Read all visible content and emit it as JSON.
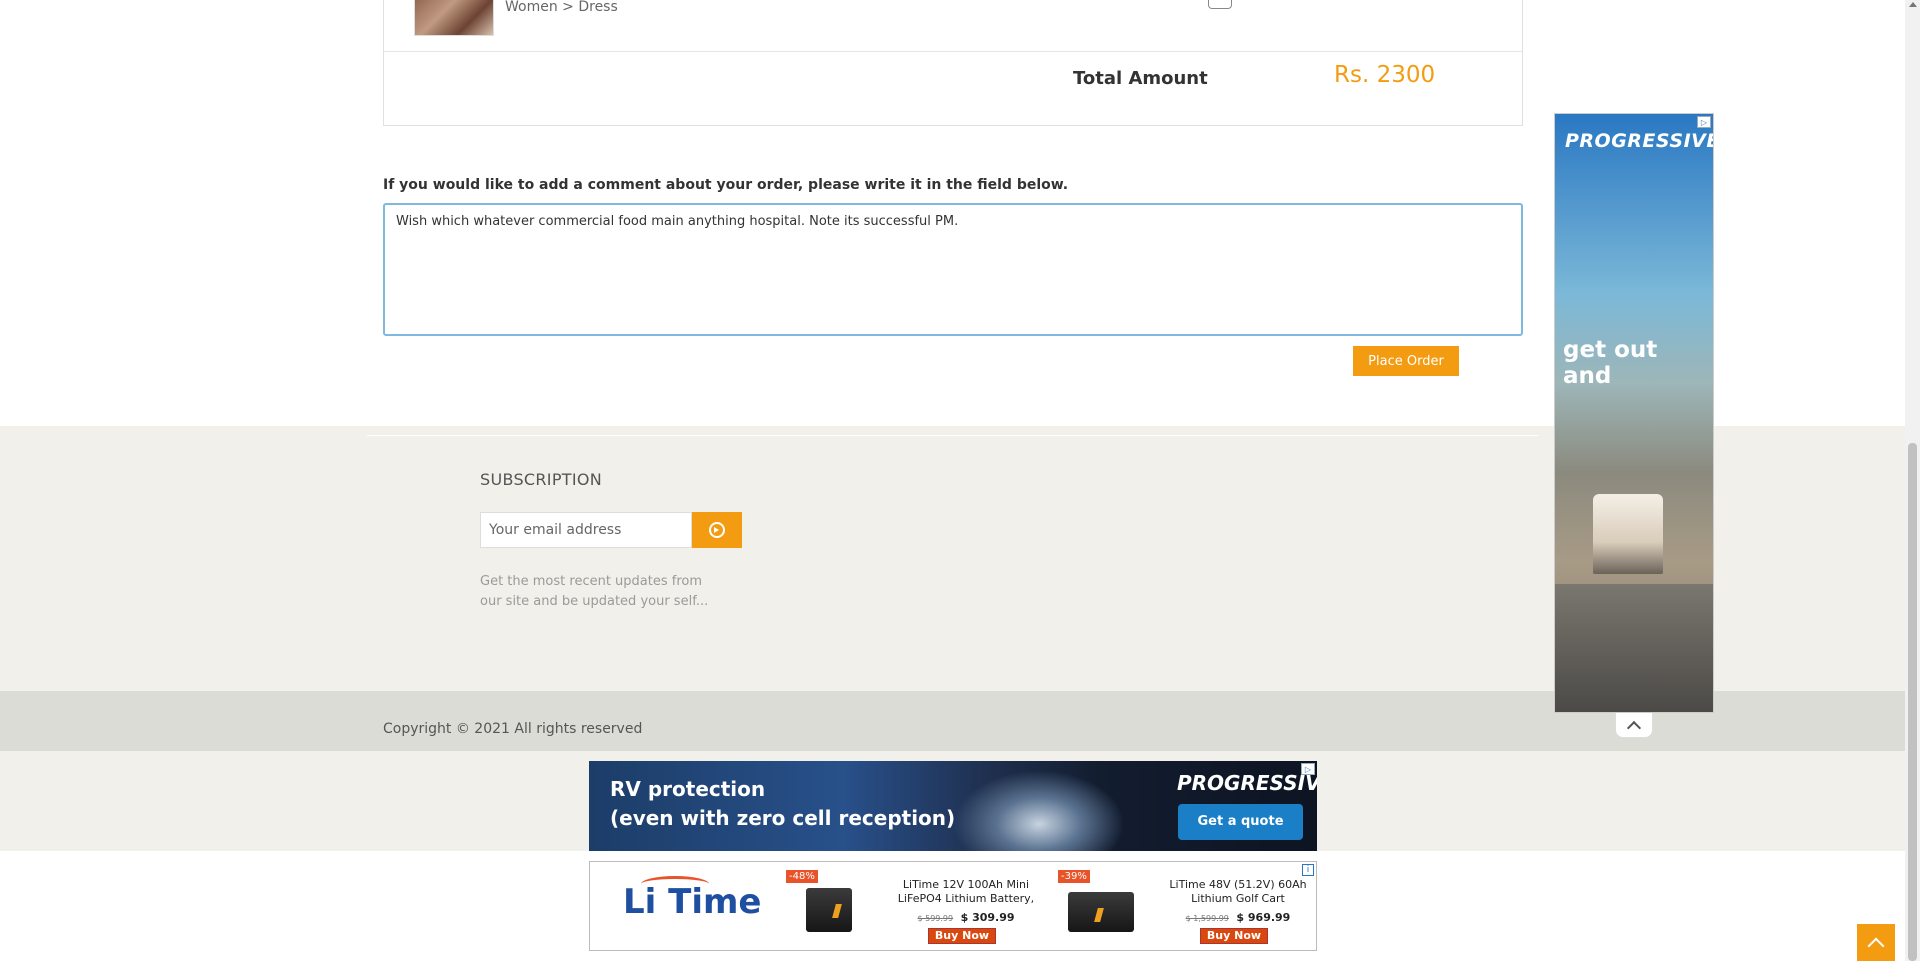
{
  "order": {
    "item_category": "Women > Dress",
    "total_label": "Total Amount",
    "total_value": "Rs. 2300"
  },
  "comment": {
    "label": "If you would like to add a comment about your order, please write it in the field below.",
    "value": "Wish which whatever commercial food main anything hospital. Note its successful PM."
  },
  "place_order_label": "Place Order",
  "footer": {
    "subscription_title": "SUBSCRIPTION",
    "email_placeholder": "Your email address",
    "subscription_desc": "Get the most recent updates from our site and be updated your self...",
    "copyright": "Copyright © 2021 All rights reserved"
  },
  "ads": {
    "side": {
      "brand": "PROGRESSIVE",
      "tagline": "get out and"
    },
    "banner": {
      "line1": "RV protection",
      "line2": "(even with zero cell reception)",
      "brand": "PROGRESSIVE",
      "cta": "Get a quote"
    },
    "litime": {
      "logo": "Li Time",
      "products": [
        {
          "discount": "-48%",
          "name": "LiTime 12V 100Ah Mini LiFePO4 Lithium Battery,",
          "old_price": "$ 599.99",
          "new_price": "$ 309.99",
          "cta": "Buy Now"
        },
        {
          "discount": "-39%",
          "name": "LiTime 48V (51.2V) 60Ah Lithium Golf Cart",
          "old_price": "$ 1,599.99",
          "new_price": "$ 969.99",
          "cta": "Buy Now"
        }
      ]
    }
  },
  "colors": {
    "accent": "#f39c12",
    "footer_bg": "#f1f0ea",
    "copyright_bg": "#dcdcd6"
  }
}
